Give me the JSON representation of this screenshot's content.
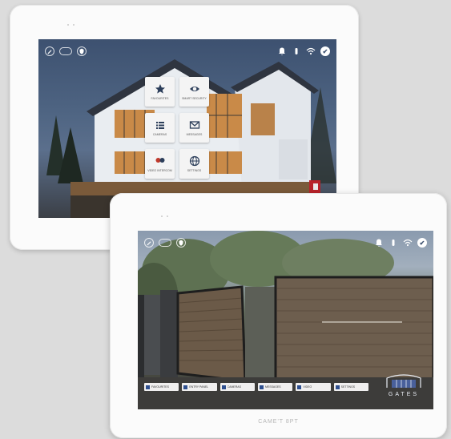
{
  "device_top": {
    "status_left_icons": [
      "edit-icon",
      "rec-pill-icon",
      "shield-icon"
    ],
    "status_right_icons": [
      "bell-icon",
      "lock-icon",
      "wifi-icon",
      "check-icon"
    ],
    "menu_tiles": [
      {
        "icon": "star-icon",
        "label": "FAVOURITES"
      },
      {
        "icon": "eye-icon",
        "label": "SMART SECURITY"
      },
      {
        "icon": "list-icon",
        "label": "CAMERAS"
      },
      {
        "icon": "mail-icon",
        "label": "MESSAGES"
      },
      {
        "icon": "people-icon",
        "label": "VIDEO INTERCOM"
      },
      {
        "icon": "globe-icon",
        "label": "SETTINGS"
      }
    ]
  },
  "device_bottom": {
    "status_left_icons": [
      "edit-icon",
      "rec-pill-icon",
      "shield-icon"
    ],
    "status_right_icons": [
      "bell-icon",
      "lock-icon",
      "wifi-icon",
      "check-icon"
    ],
    "tabs": [
      "FAVOURITES",
      "ENTRY PANEL",
      "CAMERAS",
      "MESSAGES",
      "VIDEO",
      "SETTINGS"
    ],
    "logo_text": "GATES",
    "brand_caption": "CAME'T 8PT"
  },
  "colors": {
    "tile_icon": "#2c3e5a",
    "tab_mark": "#2e4f8f",
    "bezel": "#fbfbfb"
  }
}
